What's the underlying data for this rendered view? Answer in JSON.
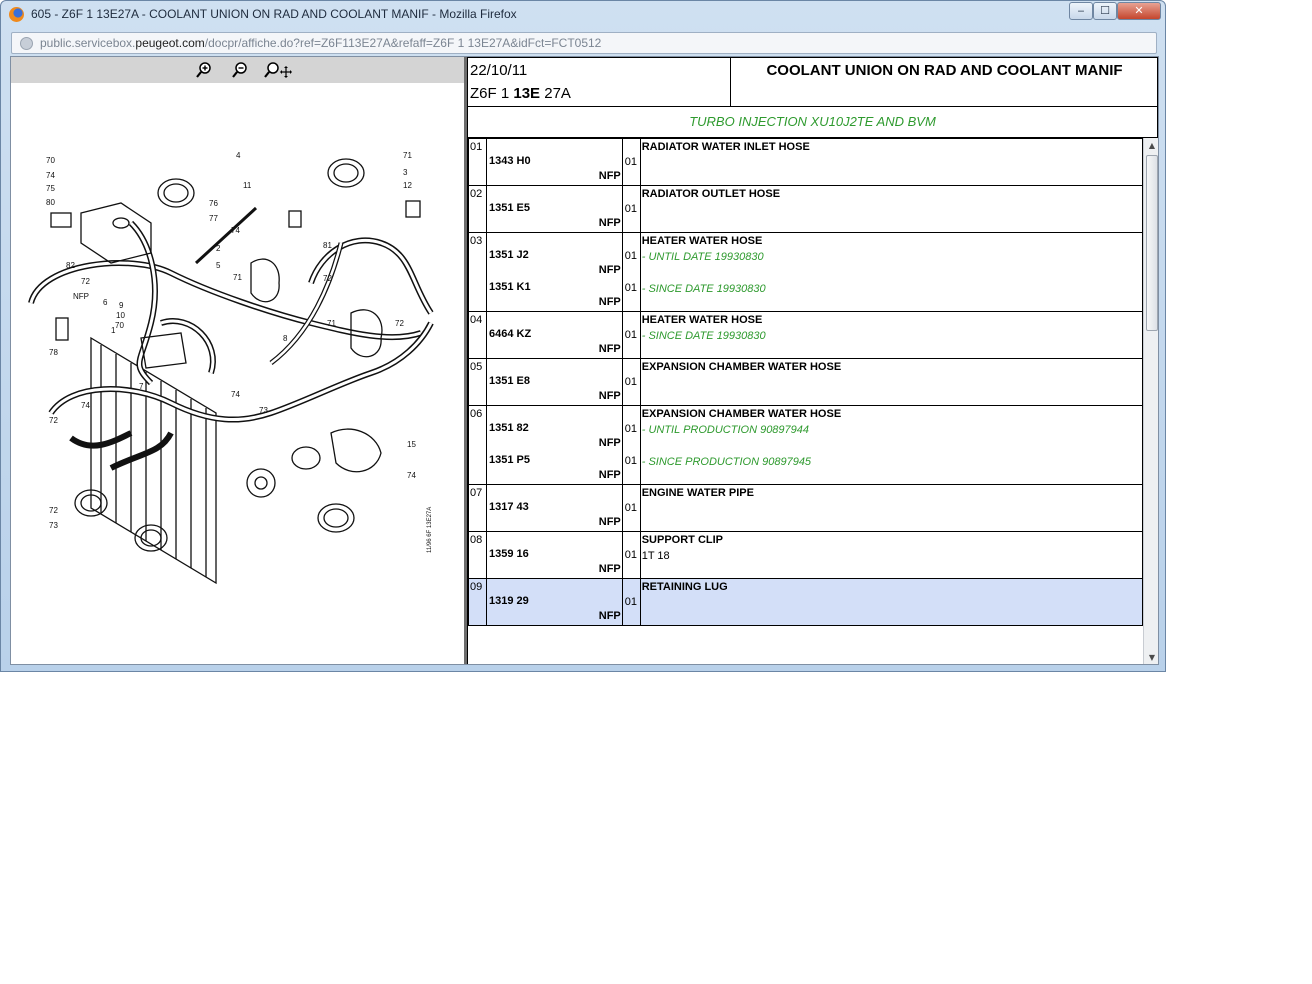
{
  "window": {
    "title": "605 - Z6F 1 13E27A - COOLANT UNION ON RAD AND COOLANT MANIF - Mozilla Firefox",
    "minimize": "‒",
    "maximize": "☐",
    "close": "✕"
  },
  "urlbar": {
    "prefix": "public.servicebox.",
    "domain": "peugeot.com",
    "path": "/docpr/affiche.do?ref=Z6F113E27A&refaff=Z6F 1 13E27A&idFct=FCT0512"
  },
  "drawing": {
    "stamp": "11/96 6F 13E27A",
    "callouts": [
      "70",
      "74",
      "75",
      "80",
      "82",
      "72",
      "NFP",
      "9",
      "10",
      "70",
      "78",
      "7",
      "74",
      "72",
      "72",
      "73",
      "4",
      "11",
      "76",
      "77",
      "2",
      "5",
      "74",
      "71",
      "1",
      "6",
      "8",
      "74",
      "73",
      "71",
      "3",
      "12",
      "81",
      "72",
      "71",
      "72",
      "15",
      "74"
    ]
  },
  "header": {
    "date": "22/10/11",
    "code_a": "Z6F 1 ",
    "code_b": "13E",
    "code_c": " 27A",
    "title": "COOLANT UNION ON RAD AND COOLANT MANIF",
    "subtitle": "TURBO INJECTION XU10J2TE AND BVM"
  },
  "parts": [
    {
      "num": "01",
      "title": "RADIATOR WATER INLET HOSE",
      "refs": [
        {
          "ref": "1343 H0",
          "nfp": "NFP",
          "qty": "01",
          "note": ""
        }
      ]
    },
    {
      "num": "02",
      "title": "RADIATOR OUTLET HOSE",
      "refs": [
        {
          "ref": "1351 E5",
          "nfp": "NFP",
          "qty": "01",
          "note": ""
        }
      ]
    },
    {
      "num": "03",
      "title": "HEATER WATER HOSE",
      "refs": [
        {
          "ref": "1351 J2",
          "nfp": "NFP",
          "qty": "01",
          "note": "- UNTIL DATE 19930830"
        },
        {
          "ref": "1351 K1",
          "nfp": "NFP",
          "qty": "01",
          "note": "- SINCE DATE 19930830"
        }
      ]
    },
    {
      "num": "04",
      "title": "HEATER WATER HOSE",
      "refs": [
        {
          "ref": "6464 KZ",
          "nfp": "NFP",
          "qty": "01",
          "note": "- SINCE DATE 19930830"
        }
      ]
    },
    {
      "num": "05",
      "title": "EXPANSION CHAMBER WATER HOSE",
      "refs": [
        {
          "ref": "1351 E8",
          "nfp": "NFP",
          "qty": "01",
          "note": ""
        }
      ]
    },
    {
      "num": "06",
      "title": "EXPANSION CHAMBER WATER HOSE",
      "refs": [
        {
          "ref": "1351 82",
          "nfp": "NFP",
          "qty": "01",
          "note": "- UNTIL PRODUCTION 90897944"
        },
        {
          "ref": "1351 P5",
          "nfp": "NFP",
          "qty": "01",
          "note": "- SINCE PRODUCTION 90897945"
        }
      ]
    },
    {
      "num": "07",
      "title": "ENGINE WATER PIPE",
      "refs": [
        {
          "ref": "1317 43",
          "nfp": "NFP",
          "qty": "01",
          "note": ""
        }
      ]
    },
    {
      "num": "08",
      "title": "SUPPORT CLIP",
      "refs": [
        {
          "ref": "1359 16",
          "nfp": "NFP",
          "qty": "01",
          "note": "1T 18",
          "plain": true
        }
      ]
    },
    {
      "num": "09",
      "title": "RETAINING LUG",
      "selected": true,
      "refs": [
        {
          "ref": "1319 29",
          "nfp": "NFP",
          "qty": "01",
          "note": ""
        }
      ]
    }
  ],
  "scrollbar": {
    "up": "▲",
    "down": "▼"
  },
  "colors": {
    "green_note": "#2e9a2e",
    "selected_row": "#d3dff8",
    "zoom_bar": "#d4d4d4"
  },
  "icons": [
    "zoom-in-icon",
    "zoom-out-icon",
    "zoom-pan-icon",
    "firefox-icon",
    "site-icon"
  ]
}
